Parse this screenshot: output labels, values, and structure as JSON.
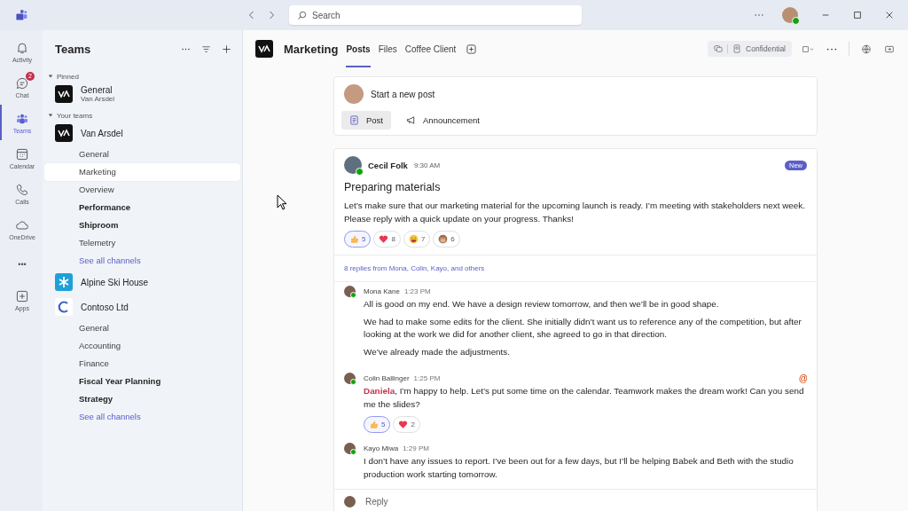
{
  "titlebar": {
    "search": {
      "placeholder": "Search"
    },
    "user": {
      "online": true
    }
  },
  "rail": [
    {
      "label": "Activity",
      "kind": "bell",
      "selected": false
    },
    {
      "label": "Chat",
      "kind": "chat",
      "selected": false,
      "badge": "2"
    },
    {
      "label": "Teams",
      "kind": "teams",
      "selected": true
    },
    {
      "label": "Calendar",
      "kind": "calendar",
      "selected": false
    },
    {
      "label": "Calls",
      "kind": "calls",
      "selected": false
    },
    {
      "label": "OneDrive",
      "kind": "cloud",
      "selected": false
    },
    {
      "label": "•••",
      "kind": "more",
      "selected": false
    },
    {
      "label": "Apps",
      "kind": "apps",
      "selected": false
    }
  ],
  "teams_panel": {
    "title": "Teams",
    "sections": [
      {
        "label": "Pinned",
        "expanded": true,
        "items": [
          {
            "name": "General",
            "subtitle": "Van Arsdel",
            "kind": "va"
          }
        ]
      },
      {
        "label": "Your teams",
        "expanded": true,
        "items": [
          {
            "name": "Van Arsdel",
            "kind": "va",
            "channels": [
              {
                "label": "General",
                "unread": false,
                "selected": false
              },
              {
                "label": "Marketing",
                "unread": false,
                "selected": true
              },
              {
                "label": "Overview",
                "unread": false,
                "selected": false
              },
              {
                "label": "Performance",
                "unread": true,
                "selected": false
              },
              {
                "label": "Shiproom",
                "unread": true,
                "selected": false
              },
              {
                "label": "Telemetry",
                "unread": false,
                "selected": false
              }
            ],
            "see_all": "See all channels"
          },
          {
            "name": "Alpine Ski House",
            "kind": "alpine"
          },
          {
            "name": "Contoso Ltd",
            "kind": "contoso",
            "channels": [
              {
                "label": "General",
                "unread": false,
                "selected": false
              },
              {
                "label": "Accounting",
                "unread": false,
                "selected": false
              },
              {
                "label": "Finance",
                "unread": false,
                "selected": false
              },
              {
                "label": "Fiscal Year Planning",
                "unread": true,
                "selected": false
              },
              {
                "label": "Strategy",
                "unread": true,
                "selected": false
              }
            ],
            "see_all": "See all channels"
          }
        ]
      }
    ]
  },
  "channel_header": {
    "title": "Marketing",
    "tabs": [
      {
        "label": "Posts",
        "selected": true
      },
      {
        "label": "Files",
        "selected": false
      },
      {
        "label": "Coffee Client",
        "selected": false
      }
    ],
    "sensitivity": "Confidential"
  },
  "compose": {
    "placeholder": "Start a new post",
    "buttons": [
      {
        "label": "Post",
        "kind": "post",
        "selected": true
      },
      {
        "label": "Announcement",
        "kind": "announcement",
        "selected": false
      }
    ]
  },
  "post": {
    "author": "Cecil Folk",
    "time": "9:30 AM",
    "online": true,
    "badge": "New",
    "title": "Preparing materials",
    "body": "Let’s make sure that our marketing material for the upcoming launch is ready. I’m meeting with stakeholders next week. Please reply with a quick update on your progress. Thanks!",
    "reactions": [
      {
        "kind": "like",
        "count": "5",
        "selected": true
      },
      {
        "kind": "heart",
        "count": "8",
        "selected": false
      },
      {
        "kind": "laugh",
        "count": "7",
        "selected": false
      },
      {
        "kind": "monkey",
        "count": "6",
        "selected": false
      }
    ],
    "replies_summary": "8 replies from Mona, Colin, Kayo, and others",
    "replies": [
      {
        "author": "Mona Kane",
        "time": "1:23 PM",
        "online": true,
        "paragraphs": [
          "All is good on my end. We have a design review tomorrow, and then we’ll be in good shape.",
          "We had to make some edits for the client. She initially didn’t want us to reference any of the competition, but after looking at the work we did for another client, she agreed to go in that direction.",
          "We’ve already made the adjustments."
        ]
      },
      {
        "author": "Colin Ballinger",
        "time": "1:25 PM",
        "online": true,
        "mention_mark": "@",
        "paragraphs": [
          "**Daniela**, I’m happy to help. Let’s put some time on the calendar. Teamwork makes the dream work! Can you send me the slides?"
        ],
        "reactions": [
          {
            "kind": "like",
            "count": "5",
            "selected": true
          },
          {
            "kind": "heart",
            "count": "2",
            "selected": false
          }
        ]
      },
      {
        "author": "Kayo Miwa",
        "time": "1:29 PM",
        "online": true,
        "paragraphs": [
          "I don’t have any issues to report. I’ve been out for a few days, but I’ll be helping Babek and Beth with the studio production work starting tomorrow."
        ]
      }
    ],
    "reply_placeholder": "Reply"
  }
}
